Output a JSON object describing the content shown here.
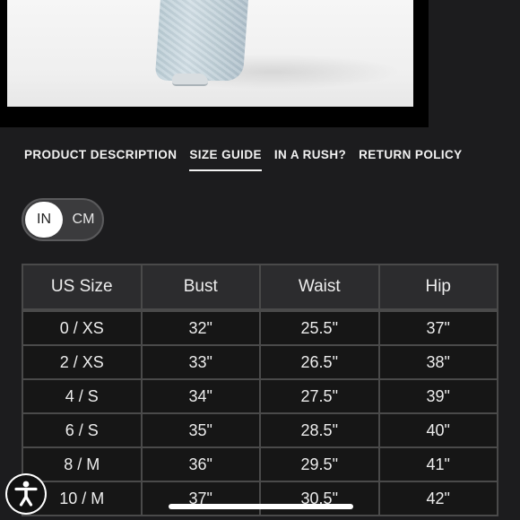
{
  "product_image": {
    "alt": "dress-photo"
  },
  "tabs": [
    {
      "label": "PRODUCT DESCRIPTION",
      "active": false
    },
    {
      "label": "SIZE GUIDE",
      "active": true
    },
    {
      "label": "IN A RUSH?",
      "active": false
    },
    {
      "label": "RETURN POLICY",
      "active": false
    }
  ],
  "unit_toggle": {
    "options": [
      "IN",
      "CM"
    ],
    "selected": "IN"
  },
  "size_table": {
    "headers": [
      "US Size",
      "Bust",
      "Waist",
      "Hip"
    ],
    "rows": [
      [
        "0 / XS",
        "32\"",
        "25.5\"",
        "37\""
      ],
      [
        "2 / XS",
        "33\"",
        "26.5\"",
        "38\""
      ],
      [
        "4 / S",
        "34\"",
        "27.5\"",
        "39\""
      ],
      [
        "6 / S",
        "35\"",
        "28.5\"",
        "40\""
      ],
      [
        "8 / M",
        "36\"",
        "29.5\"",
        "41\""
      ],
      [
        "10 / M",
        "37\"",
        "30.5\"",
        "42\""
      ]
    ]
  },
  "icons": {
    "accessibility": "accessibility-icon"
  },
  "colors": {
    "background": "#1c1c1e",
    "text": "#f2f2f2",
    "table_border": "#4a4a4a"
  }
}
